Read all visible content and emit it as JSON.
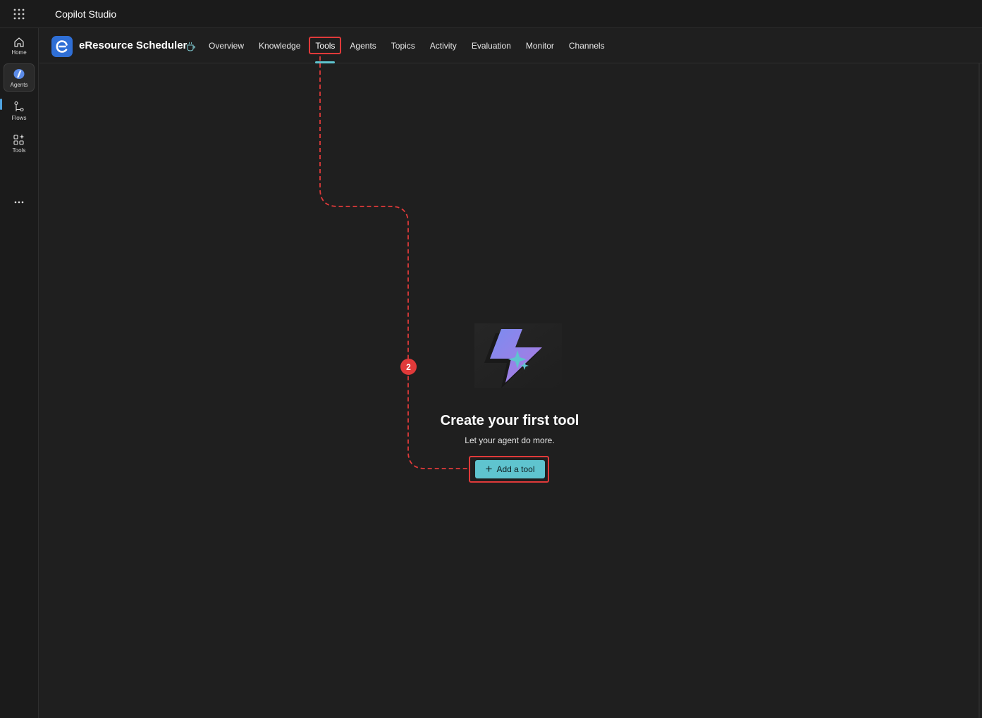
{
  "app": {
    "title": "Copilot Studio"
  },
  "rail": {
    "items": [
      {
        "label": "Home",
        "icon": "home-icon"
      },
      {
        "label": "Agents",
        "icon": "agents-icon",
        "active": true
      },
      {
        "label": "Flows",
        "icon": "flows-icon"
      },
      {
        "label": "Tools",
        "icon": "tools-icon"
      }
    ],
    "more_icon": "more-icon"
  },
  "agent": {
    "name": "eResource Scheduler",
    "logo_letter": "e"
  },
  "tabs": [
    {
      "label": "Overview"
    },
    {
      "label": "Knowledge"
    },
    {
      "label": "Tools",
      "active": true
    },
    {
      "label": "Agents"
    },
    {
      "label": "Topics"
    },
    {
      "label": "Activity"
    },
    {
      "label": "Evaluation"
    },
    {
      "label": "Monitor"
    },
    {
      "label": "Channels"
    }
  ],
  "empty_state": {
    "title": "Create your first tool",
    "subtitle": "Let your agent do more.",
    "button_label": "Add a tool",
    "icon": "lightning-sparkle-icon"
  },
  "annotation": {
    "step_number": "2",
    "color": "#e03a3a"
  },
  "colors": {
    "accent": "#5fc4cf",
    "background": "#1f1f1f",
    "highlight": "#e03a3a"
  }
}
